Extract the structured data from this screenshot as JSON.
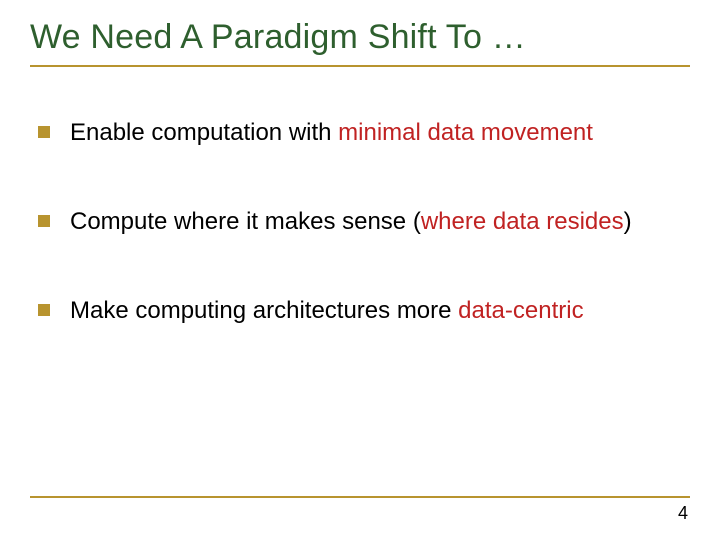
{
  "title": "We Need A Paradigm Shift To …",
  "bullets": [
    {
      "pre": "Enable computation with ",
      "highlight": "minimal data movement",
      "post": ""
    },
    {
      "pre": "Compute where it makes sense (",
      "highlight": "where data resides",
      "post": ")"
    },
    {
      "pre": "Make computing architectures more ",
      "highlight": "data-centric",
      "post": ""
    }
  ],
  "page_number": "4"
}
